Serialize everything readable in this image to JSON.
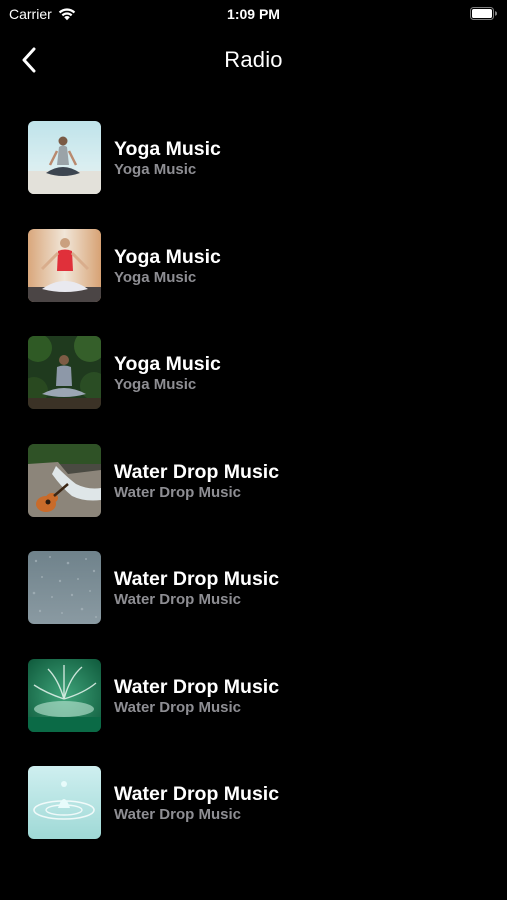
{
  "status_bar": {
    "carrier": "Carrier",
    "time": "1:09 PM"
  },
  "nav": {
    "title": "Radio",
    "back_icon": "chevron-left-icon"
  },
  "stations": [
    {
      "title": "Yoga Music",
      "subtitle": "Yoga Music",
      "thumbnail": "yoga-meditation-beach"
    },
    {
      "title": "Yoga Music",
      "subtitle": "Yoga Music",
      "thumbnail": "yoga-meditation-red-top"
    },
    {
      "title": "Yoga Music",
      "subtitle": "Yoga Music",
      "thumbnail": "yoga-meditation-forest"
    },
    {
      "title": "Water Drop Music",
      "subtitle": "Water Drop Music",
      "thumbnail": "stream-with-guitar"
    },
    {
      "title": "Water Drop Music",
      "subtitle": "Water Drop Music",
      "thumbnail": "rain-on-water"
    },
    {
      "title": "Water Drop Music",
      "subtitle": "Water Drop Music",
      "thumbnail": "water-splash-green"
    },
    {
      "title": "Water Drop Music",
      "subtitle": "Water Drop Music",
      "thumbnail": "water-droplet-ripple"
    }
  ],
  "colors": {
    "background": "#000000",
    "primary_text": "#ffffff",
    "secondary_text": "#8e8e93"
  }
}
